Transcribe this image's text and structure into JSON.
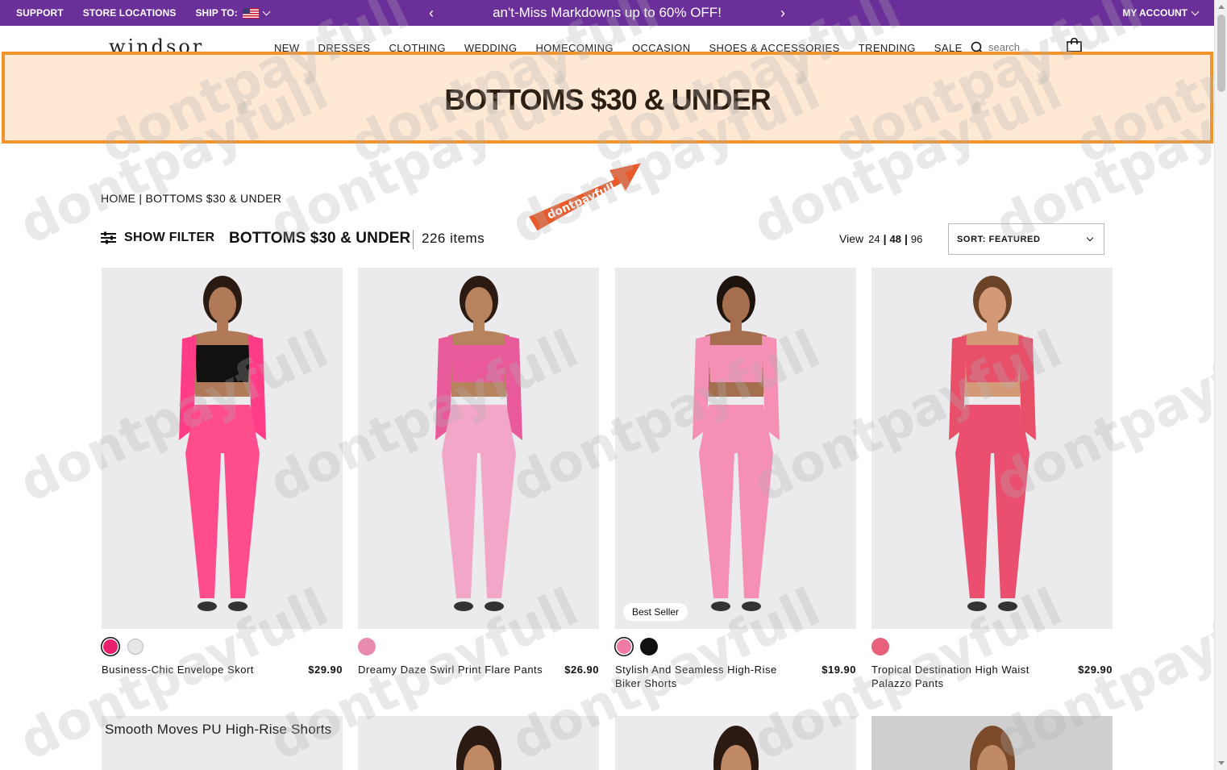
{
  "topbar": {
    "support": "SUPPORT",
    "store_locations": "STORE LOCATIONS",
    "ship_to": "SHIP TO:",
    "promo_text": "an't-Miss Markdowns up to 60% OFF!",
    "prev": "‹",
    "next": "›",
    "my_account": "MY ACCOUNT"
  },
  "nav": {
    "logo": "windsor",
    "items": [
      "NEW",
      "DRESSES",
      "CLOTHING",
      "WEDDING",
      "HOMECOMING",
      "OCCASION",
      "SHOES & ACCESSORIES",
      "TRENDING",
      "SALE"
    ],
    "search_placeholder": "search"
  },
  "hero": {
    "title": "BOTTOMS $30 & UNDER"
  },
  "breadcrumb": "HOME | BOTTOMS $30 & UNDER",
  "sticker": {
    "text": "dontpayfull"
  },
  "toolbar": {
    "filter_label": "SHOW FILTER",
    "category_title": "BOTTOMS $30 & UNDER",
    "item_count": "226 items",
    "view_label": "View",
    "view_options": [
      "24",
      "48",
      "96"
    ],
    "view_selected": "48",
    "sort_label": "SORT: FEATURED"
  },
  "products": [
    {
      "name": "Business-Chic Envelope Skort",
      "price": "$29.90",
      "badge": "",
      "swatches": [
        "#e8206e",
        "#e6e6e6"
      ],
      "colors": {
        "top": "#ff3d86",
        "bottom": "#ff4c8c",
        "bra": "#111111",
        "skin": "#b07a58",
        "hair": "#2a1a12"
      }
    },
    {
      "name": "Dreamy Daze Swirl Print Flare Pants",
      "price": "$26.90",
      "badge": "",
      "swatches": [
        "#e98bb0"
      ],
      "colors": {
        "top": "#e85a9a",
        "bottom": "#f2a6c8",
        "bra": "#e85a9a",
        "skin": "#b7825e",
        "hair": "#2a1a12"
      }
    },
    {
      "name": "Stylish And Seamless High-Rise Biker Shorts",
      "price": "$19.90",
      "badge": "Best Seller",
      "swatches": [
        "#f07aa6",
        "#111111"
      ],
      "colors": {
        "top": "#f58fb6",
        "bottom": "#f58fb6",
        "bra": "#f58fb6",
        "skin": "#a56f4f",
        "hair": "#1e140e"
      }
    },
    {
      "name": "Tropical Destination High Waist Palazzo Pants",
      "price": "$29.90",
      "badge": "",
      "swatches": [
        "#e8607a"
      ],
      "colors": {
        "top": "#e8506a",
        "bottom": "#ea4f70",
        "bra": "#e8506a",
        "skin": "#d49a78",
        "hair": "#6b4326"
      }
    }
  ],
  "row2": [
    {
      "label": "Smooth Moves PU High-Rise Shorts"
    },
    {
      "label": ""
    },
    {
      "label": ""
    },
    {
      "label": ""
    }
  ],
  "watermark": "dontpayfull"
}
